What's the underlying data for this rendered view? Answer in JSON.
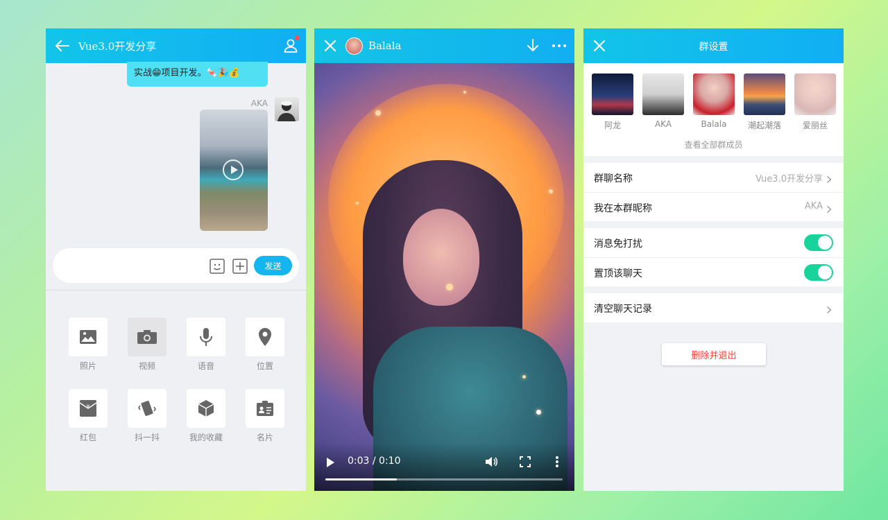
{
  "chat": {
    "title": "Vue3.0开发分享",
    "bubble_text": "实战😁项目开发。🍬🎉💰",
    "sender": "AKA",
    "input_value": "",
    "send_label": "发送",
    "tools": [
      {
        "label": "照片",
        "icon": "image-icon"
      },
      {
        "label": "视频",
        "icon": "camera-icon"
      },
      {
        "label": "语音",
        "icon": "microphone-icon"
      },
      {
        "label": "位置",
        "icon": "location-pin-icon"
      },
      {
        "label": "红包",
        "icon": "red-envelope-icon"
      },
      {
        "label": "抖一抖",
        "icon": "shake-icon"
      },
      {
        "label": "我的收藏",
        "icon": "cube-icon"
      },
      {
        "label": "名片",
        "icon": "contact-card-icon"
      }
    ]
  },
  "video": {
    "title": "Balala",
    "time": "0:03 / 0:10",
    "progress": 0.3
  },
  "settings": {
    "title": "群设置",
    "members": [
      {
        "name": "阿龙",
        "color": "#1b2a5a"
      },
      {
        "name": "AKA",
        "color": "#c9c9c9"
      },
      {
        "name": "Balala",
        "color": "#e9c2c0"
      },
      {
        "name": "潮起潮落",
        "color": "#d9774a"
      },
      {
        "name": "爱丽丝",
        "color": "#e8d2d2"
      }
    ],
    "view_all": "查看全部群成员",
    "group_name_label": "群聊名称",
    "group_name_value": "Vue3.0开发分享",
    "nickname_label": "我在本群昵称",
    "nickname_value": "AKA",
    "mute_label": "消息免打扰",
    "mute_on": true,
    "pin_label": "置顶该聊天",
    "pin_on": true,
    "clear_label": "清空聊天记录",
    "exit_label": "删除并退出"
  },
  "colors": {
    "header": "#12b9ee",
    "toggle_on": "#19d49a",
    "danger": "#ff3b30"
  }
}
